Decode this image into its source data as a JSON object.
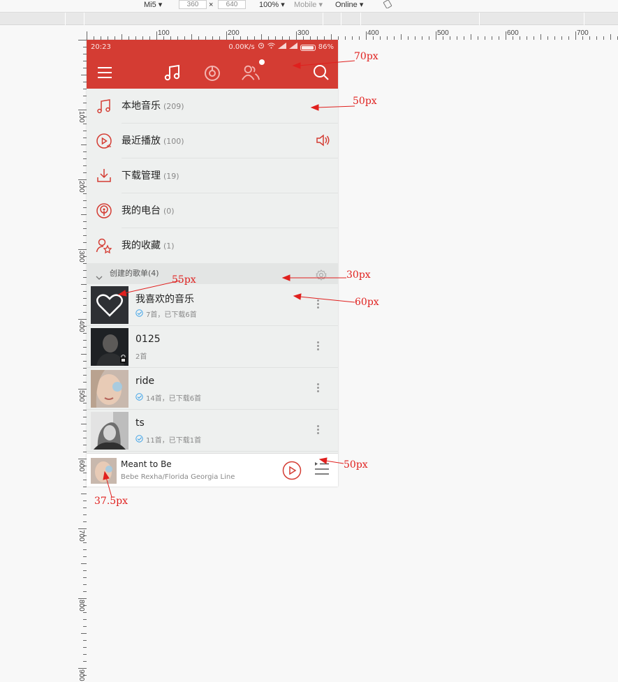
{
  "devtools": {
    "device": "Mi5",
    "width": "360",
    "height": "640",
    "zoom": "100%",
    "network_mode": "Mobile",
    "online": "Online",
    "separator": "×"
  },
  "ruler": {
    "h_labels": [
      "100",
      "200",
      "300",
      "400",
      "500",
      "600",
      "700"
    ],
    "v_labels": [
      "100",
      "200",
      "300",
      "400",
      "500",
      "600",
      "700",
      "800",
      "900"
    ]
  },
  "phone": {
    "status": {
      "time": "20:23",
      "speed": "0.00K/s",
      "battery": "86%"
    },
    "menu": [
      {
        "label": "本地音乐",
        "count": "(209)",
        "icon": "music-note-icon"
      },
      {
        "label": "最近播放",
        "count": "(100)",
        "icon": "recent-play-icon"
      },
      {
        "label": "下载管理",
        "count": "(19)",
        "icon": "download-icon"
      },
      {
        "label": "我的电台",
        "count": "(0)",
        "icon": "radio-icon"
      },
      {
        "label": "我的收藏",
        "count": "(1)",
        "icon": "favorite-user-icon"
      }
    ],
    "section": {
      "title": "创建的歌单(4)"
    },
    "playlists": [
      {
        "name": "我喜欢的音乐",
        "sub": "7首，已下载6首",
        "downloaded": true
      },
      {
        "name": "0125",
        "sub": "2首",
        "downloaded": false
      },
      {
        "name": "ride",
        "sub": "14首，已下载6首",
        "downloaded": true
      },
      {
        "name": "ts",
        "sub": "11首，已下载1首",
        "downloaded": true
      }
    ],
    "player": {
      "song": "Meant to Be",
      "artist": "Bebe Rexha/Florida Georgia Line"
    }
  },
  "annotations": [
    "70px",
    "50px",
    "30px",
    "55px",
    "60px",
    "50px",
    "37.5px"
  ],
  "colors": {
    "brand_red": "#d43c33",
    "annotation_red": "#e0201e",
    "background": "#eef0ef"
  }
}
